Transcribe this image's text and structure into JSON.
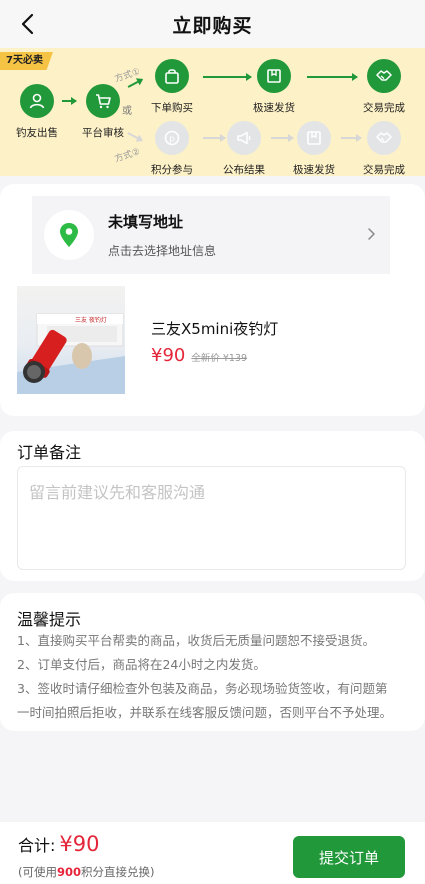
{
  "header": {
    "title": "立即购买"
  },
  "flow": {
    "badge": "7天必卖",
    "or_text": "或",
    "way1": "方式①",
    "way2": "方式②",
    "steps": {
      "seller": "钓友出售",
      "review": "平台审核",
      "order": "下单购买",
      "ship1": "极速发货",
      "done1": "交易完成",
      "points": "积分参与",
      "result": "公布结果",
      "ship2": "极速发货",
      "done2": "交易完成"
    }
  },
  "address": {
    "title": "未填写地址",
    "hint": "点击去选择地址信息"
  },
  "product": {
    "name": "三友X5mini夜钓灯",
    "price": "¥90",
    "original_price": "全新价 ¥139"
  },
  "remark": {
    "title": "订单备注",
    "placeholder": "留言前建议先和客服沟通"
  },
  "tips": {
    "title": "温馨提示",
    "lines": [
      "1、直接购买平台帮卖的商品，收货后无质量问题恕不接受退货。",
      "2、订单支付后，商品将在24小时之内发货。",
      "3、签收时请仔细检查外包装及商品，务必现场验货签收，有问题第",
      "一时间拍照后拒收，并联系在线客服反馈问题，否则平台不予处理。"
    ]
  },
  "footer": {
    "total_label": "合计:",
    "total_value": "¥90",
    "points_prefix": "(可使用",
    "points_value": "900",
    "points_suffix": "积分直接兑换)",
    "submit_label": "提交订单"
  },
  "colors": {
    "accent": "#21983a",
    "price": "#e5263a",
    "flow_bg": "#fdf1c7"
  }
}
